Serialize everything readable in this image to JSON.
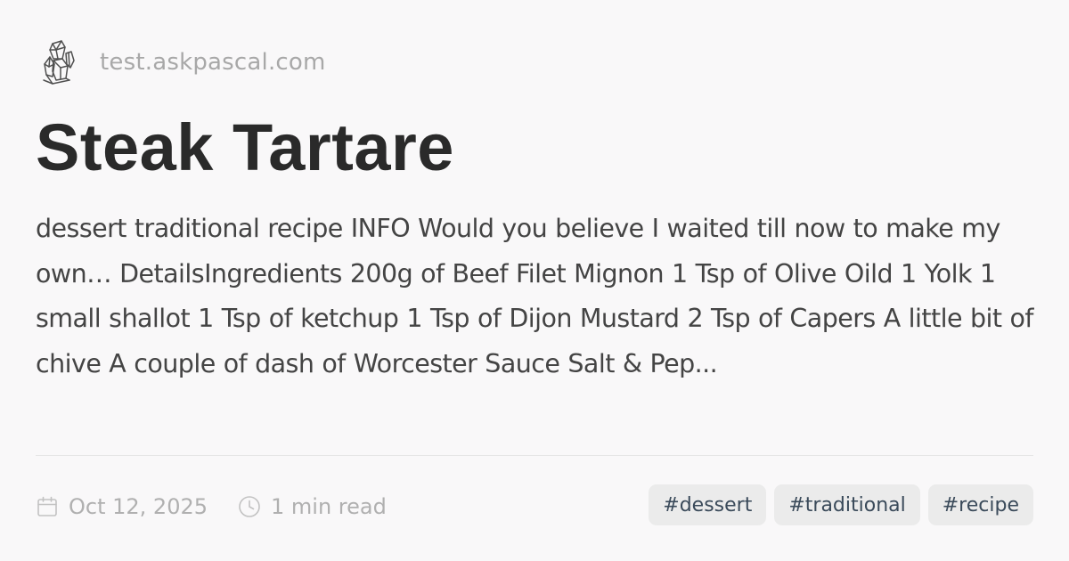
{
  "site": {
    "domain": "test.askpascal.com",
    "logo_icon": "crystal-icon"
  },
  "post": {
    "title": "Steak Tartare",
    "excerpt": "dessert traditional recipe INFO Would you believe I waited till now to make my own… DetailsIngredients 200g of Beef Filet Mignon 1 Tsp of Olive Oild 1 Yolk 1 small shallot 1 Tsp of ketchup 1 Tsp of Dijon Mustard 2 Tsp of Capers A little bit of chive A couple of dash of Worcester Sauce Salt & Pep...",
    "date": "Oct 12, 2025",
    "read_time": "1 min read",
    "date_icon": "calendar-icon",
    "time_icon": "clock-icon",
    "tags": [
      "#dessert",
      "#traditional",
      "#recipe"
    ]
  },
  "colors": {
    "background": "#f9f8f9",
    "title": "#2a2a2a",
    "excerpt": "#444444",
    "muted": "#b0b0b0",
    "tag_bg": "#ebebeb",
    "tag_text": "#3a4a5a"
  }
}
